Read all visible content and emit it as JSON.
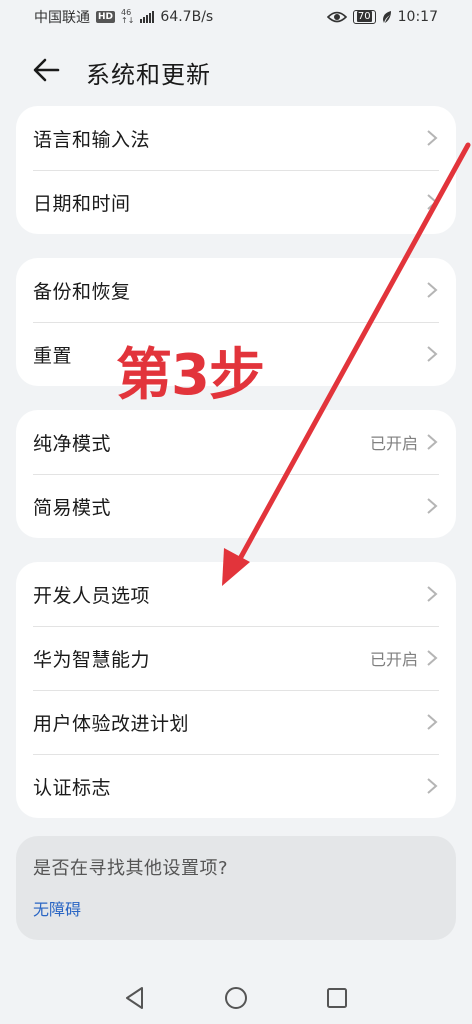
{
  "status": {
    "carrier": "中国联通",
    "hd": "HD",
    "net_type_top": "46",
    "net_type_bottom": "↑↓",
    "speed": "64.7B/s",
    "battery": "70",
    "time": "10:17"
  },
  "header": {
    "title": "系统和更新"
  },
  "groups": [
    {
      "items": [
        {
          "label": "语言和输入法"
        },
        {
          "label": "日期和时间"
        }
      ]
    },
    {
      "items": [
        {
          "label": "备份和恢复"
        },
        {
          "label": "重置"
        }
      ]
    },
    {
      "items": [
        {
          "label": "纯净模式",
          "value": "已开启"
        },
        {
          "label": "简易模式"
        }
      ]
    },
    {
      "items": [
        {
          "label": "开发人员选项"
        },
        {
          "label": "华为智慧能力",
          "value": "已开启"
        },
        {
          "label": "用户体验改进计划"
        },
        {
          "label": "认证标志"
        }
      ]
    }
  ],
  "help": {
    "title": "是否在寻找其他设置项?",
    "link": "无障碍"
  },
  "annotation": {
    "step_label": "第3步",
    "color": "#e2343b"
  },
  "colors": {
    "background": "#f1f3f5",
    "card": "#ffffff",
    "link": "#2a66c4"
  }
}
